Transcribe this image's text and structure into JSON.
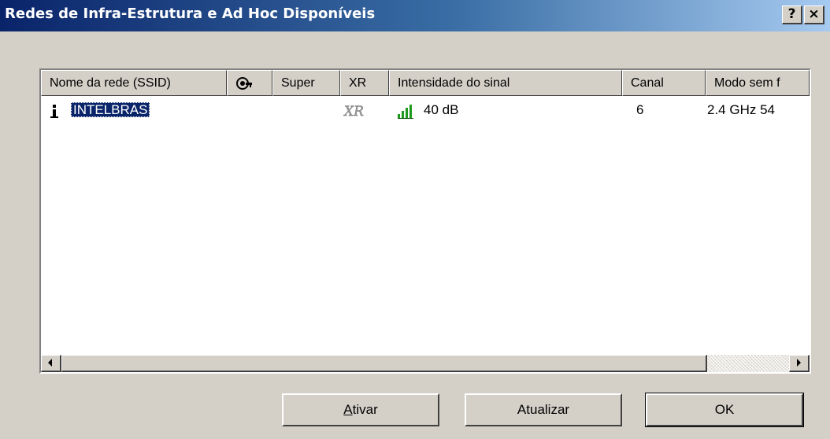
{
  "window": {
    "title": "Redes de Infra-Estrutura e Ad Hoc Disponíveis",
    "help_label": "?",
    "close_label": "×"
  },
  "list": {
    "columns": [
      {
        "label": "Nome da rede (SSID)"
      },
      {
        "label": "",
        "icon": "security-key-icon"
      },
      {
        "label": "Super"
      },
      {
        "label": "XR"
      },
      {
        "label": "Intensidade do sinal"
      },
      {
        "label": "Canal"
      },
      {
        "label": "Modo sem f"
      }
    ],
    "rows": [
      {
        "network_icon": "access-point-icon",
        "ssid": "INTELBRAS",
        "super": "",
        "xr_icon": "xr-icon",
        "xr_text": "XR",
        "signal_icon": "signal-bars-icon",
        "signal": "40 dB",
        "channel": "6",
        "mode": "2.4 GHz 54",
        "selected": true
      }
    ]
  },
  "buttons": {
    "ativar_mnemonic": "A",
    "ativar_rest": "tivar",
    "atualizar": "Atualizar",
    "ok": "OK"
  },
  "colors": {
    "titlebar_start": "#0a246a",
    "titlebar_end": "#a6caf0",
    "face": "#d4d0c8",
    "selection": "#0a246a",
    "signal_green": "#1f9a1f"
  }
}
